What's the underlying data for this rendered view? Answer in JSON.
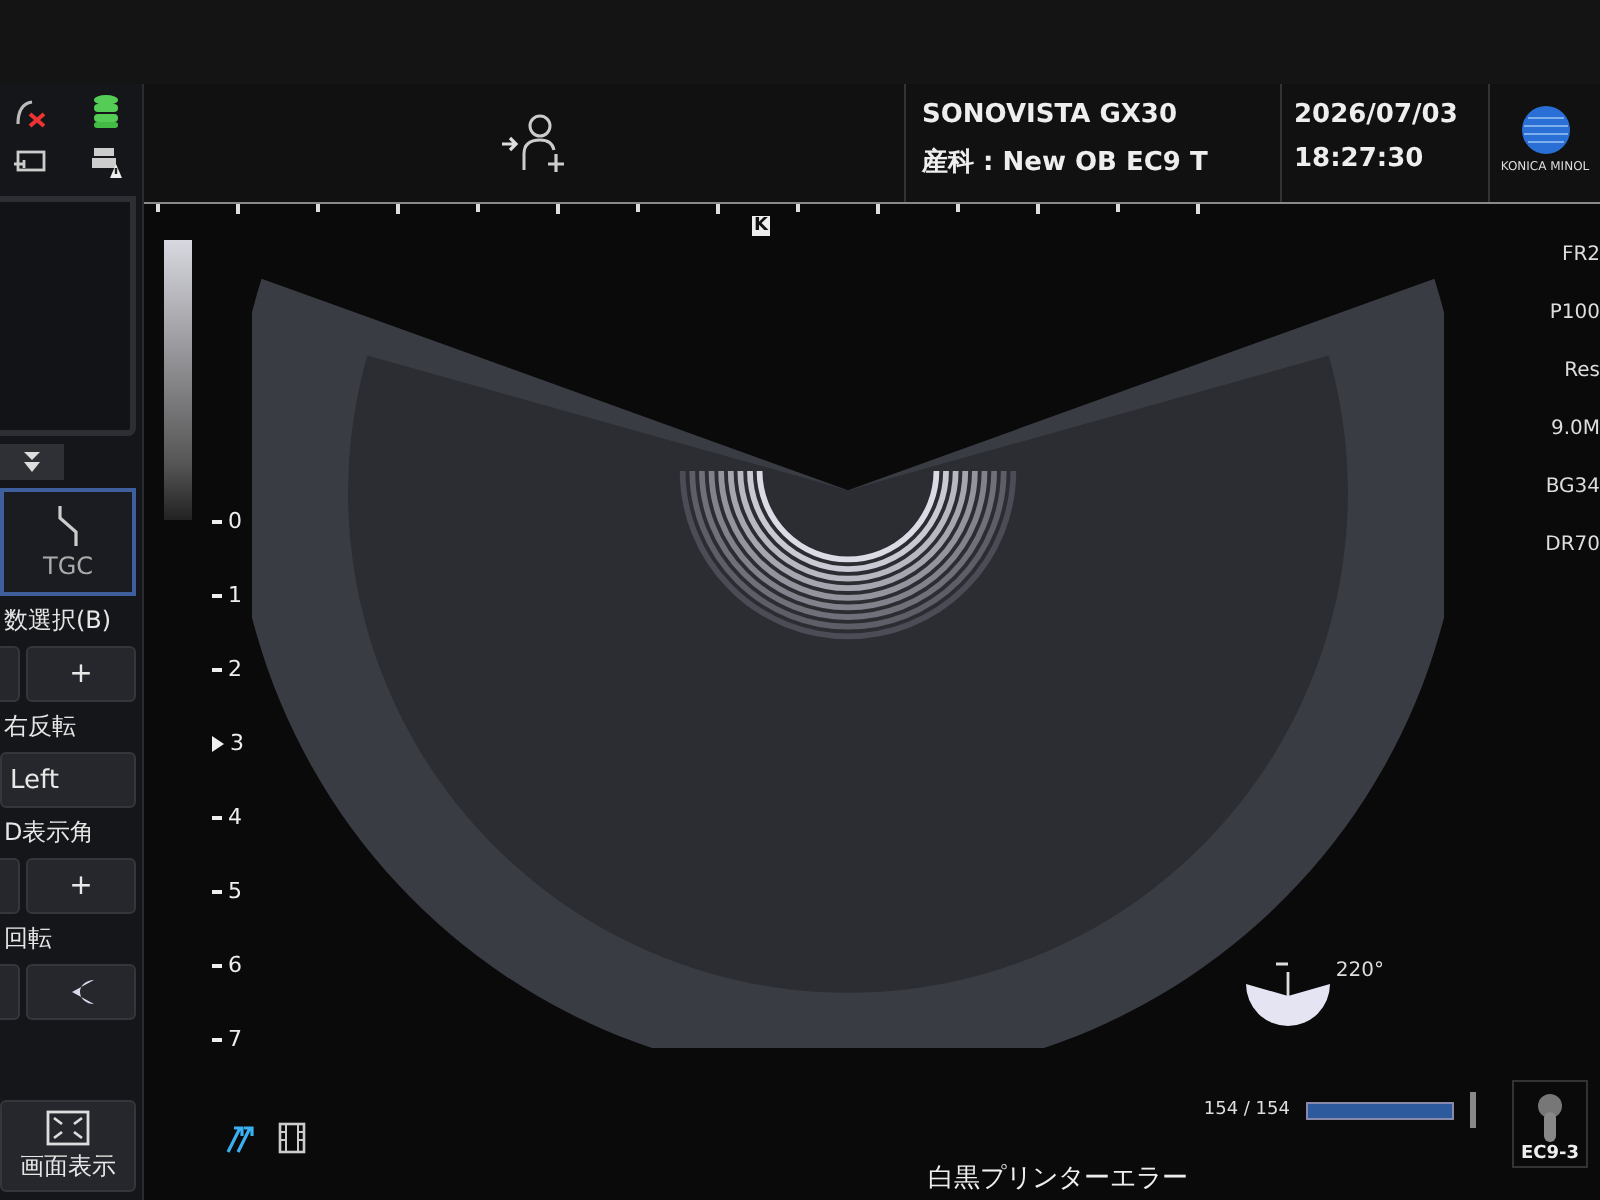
{
  "header": {
    "system": "SONOVISTA GX30",
    "preset": "産科 : New OB EC9 T",
    "date": "2026/07/03",
    "time": "18:27:30",
    "logo": "KONICA MINOL"
  },
  "left_panel": {
    "tgc_button": {
      "label": "TGC",
      "selected": true
    },
    "sections": [
      {
        "label": "数選択(B)",
        "kind": "stepper",
        "value": "+"
      },
      {
        "label": "右反転",
        "kind": "toggle",
        "value": "Left"
      },
      {
        "label": "D表示角",
        "kind": "stepper",
        "value": "+"
      },
      {
        "label": "回転",
        "kind": "rotate"
      }
    ],
    "fullscreen_button": {
      "label": "画面表示"
    }
  },
  "ruler_marker": "K",
  "depth_scale": [
    {
      "label": "0",
      "focus": false
    },
    {
      "label": "1",
      "focus": false
    },
    {
      "label": "2",
      "focus": false
    },
    {
      "label": "3",
      "focus": true
    },
    {
      "label": "4",
      "focus": false
    },
    {
      "label": "5",
      "focus": false
    },
    {
      "label": "6",
      "focus": false
    },
    {
      "label": "7",
      "focus": false
    }
  ],
  "parameters": [
    "FR2",
    "P100",
    "Res",
    "9.0M",
    "BG34",
    "DR70"
  ],
  "angle": {
    "reading": "220°"
  },
  "cine": {
    "reading": "154 / 154",
    "level": 1
  },
  "probe": {
    "label": "EC9-3"
  },
  "status_message": "白黒プリンターエラー"
}
